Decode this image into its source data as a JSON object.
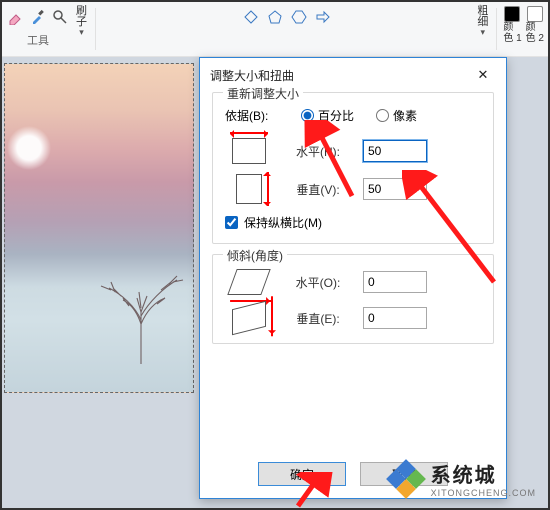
{
  "ribbon": {
    "brushes_label": "刷\n子",
    "tools_label": "工具",
    "thickness_label": "粗\n细",
    "color1_label": "颜\n色 1",
    "color2_label": "颜\n色 2"
  },
  "dialog": {
    "title": "调整大小和扭曲",
    "close": "✕",
    "resize": {
      "legend": "重新调整大小",
      "basis_label": "依据(B):",
      "percent_label": "百分比",
      "pixels_label": "像素",
      "horizontal_label": "水平(H):",
      "vertical_label": "垂直(V):",
      "horizontal_value": "50",
      "vertical_value": "50",
      "keep_ratio_label": "保持纵横比(M)",
      "keep_ratio_checked": true,
      "basis_selected": "percent"
    },
    "skew": {
      "legend": "倾斜(角度)",
      "horizontal_label": "水平(O):",
      "vertical_label": "垂直(E):",
      "horizontal_value": "0",
      "vertical_value": "0"
    },
    "ok_label": "确定",
    "cancel_label": "取消"
  },
  "watermark": {
    "title": "系统城",
    "sub": "XITONGCHENG.COM"
  }
}
